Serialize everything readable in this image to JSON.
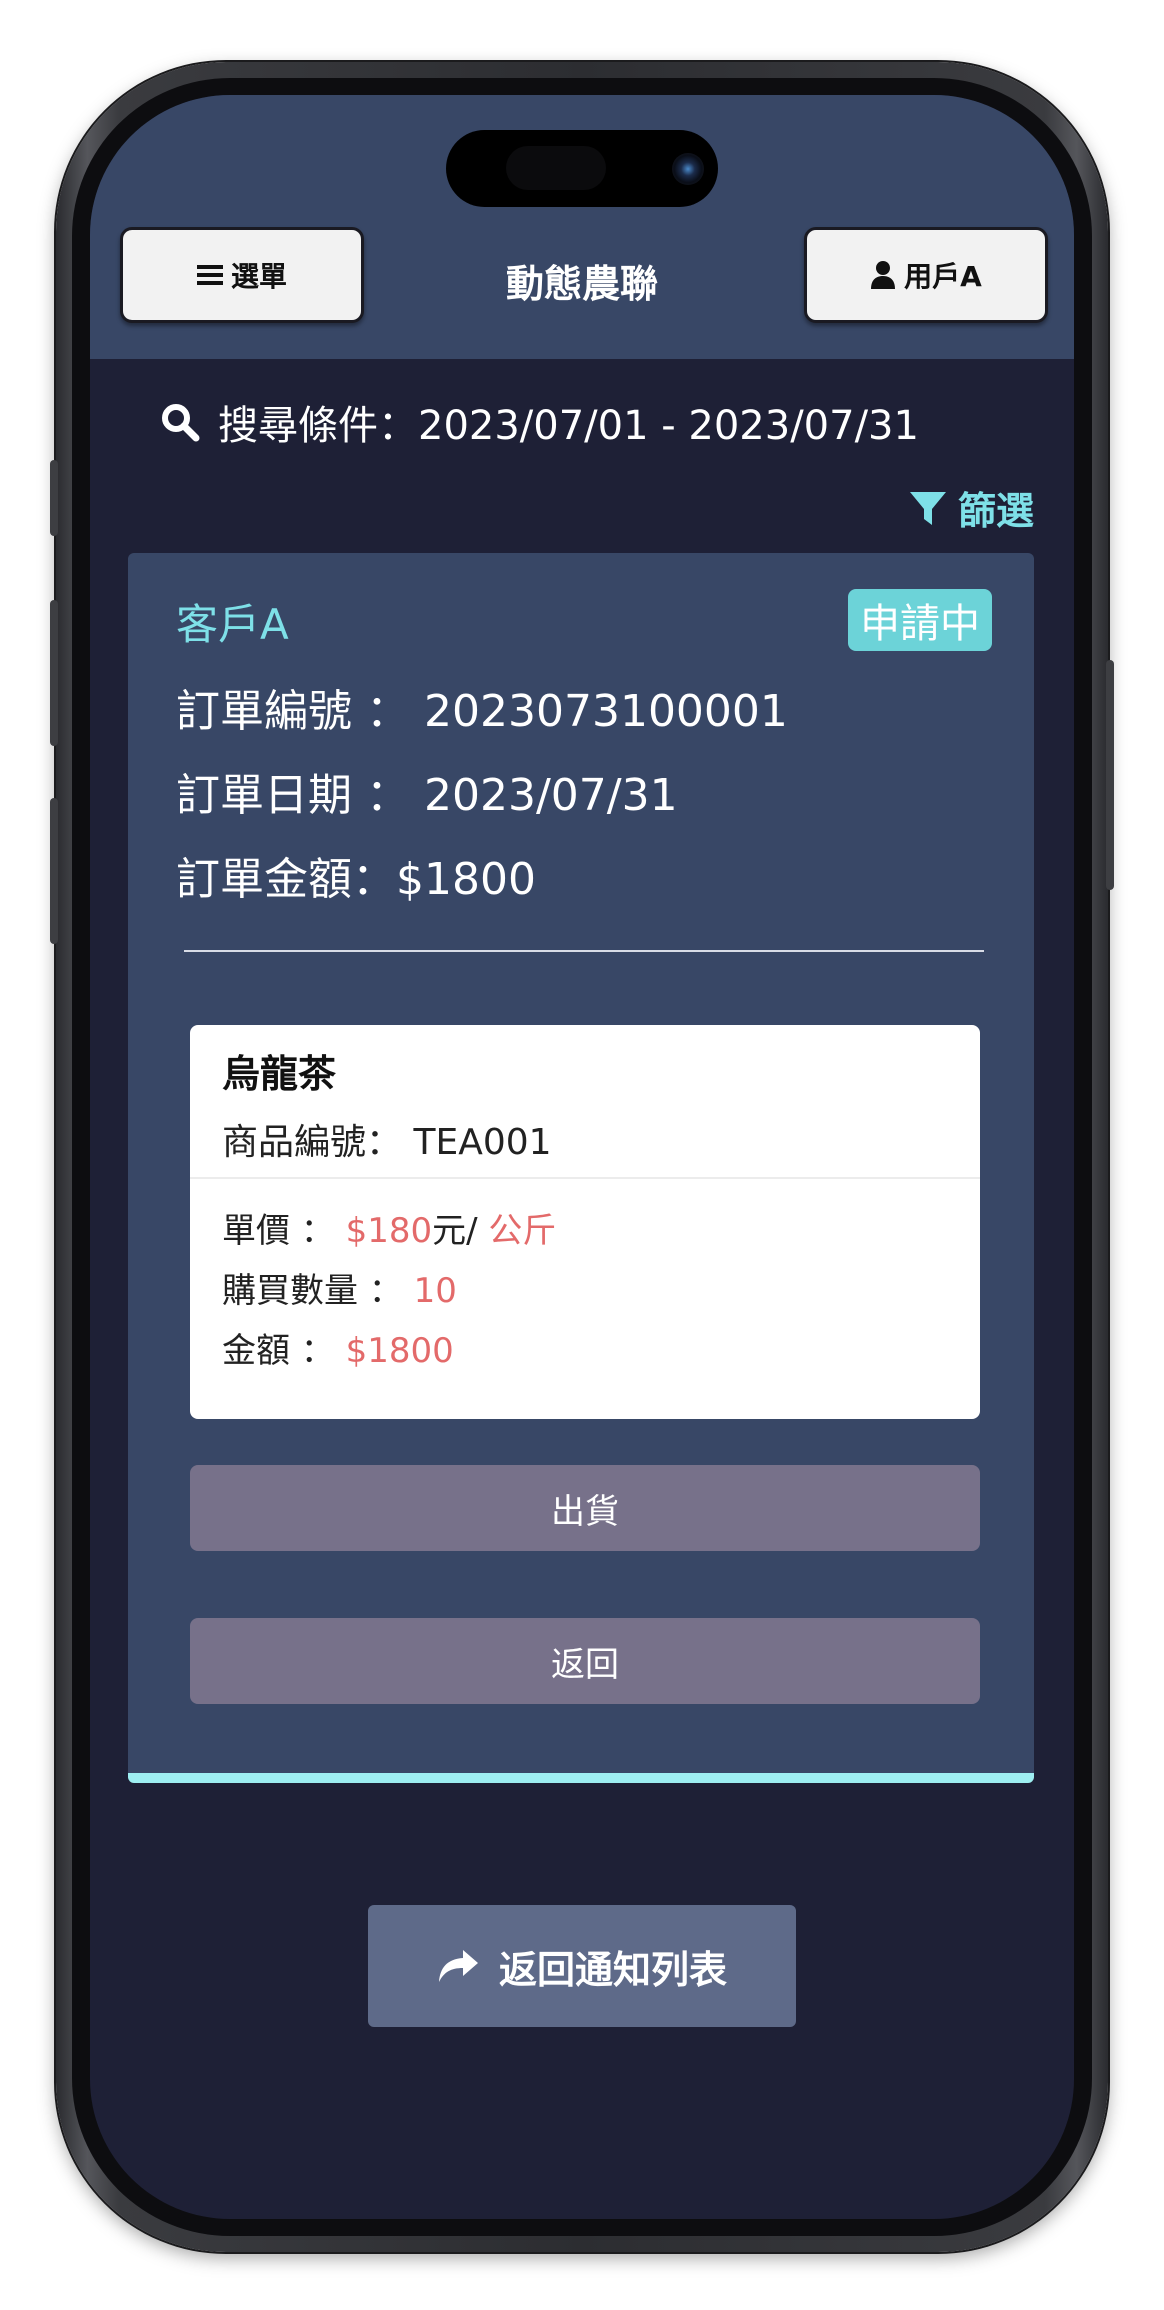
{
  "header": {
    "menu_label": "選單",
    "title": "動態農聯",
    "user_label": "用戶A",
    "menu_icon": "hamburger-icon",
    "user_icon": "user-icon"
  },
  "search": {
    "icon": "search-icon",
    "text": "搜尋條件：2023/07/01 - 2023/07/31"
  },
  "filter": {
    "icon": "filter-icon",
    "label": "篩選"
  },
  "order": {
    "customer": "客戶A",
    "status": "申請中",
    "number_label": "訂單編號 ： ",
    "number": "2023073100001",
    "date_label": "訂單日期 ： ",
    "date": "2023/07/31",
    "amount_label": "訂單金額：",
    "amount": "$1800"
  },
  "product": {
    "name": "烏龍茶",
    "code_label": "商品編號： ",
    "code": "TEA001",
    "price_label": "單價 ： ",
    "price": "$180",
    "price_unit_sep": "元/ ",
    "unit": "公斤",
    "qty_label": "購買數量 ： ",
    "qty": "10",
    "total_label": "金額 ： ",
    "total": "$1800"
  },
  "actions": {
    "ship_label": "出貨",
    "back_label": "返回",
    "back_list_label": "返回通知列表",
    "back_list_icon": "share-arrow-icon"
  },
  "colors": {
    "accent": "#7ee0e8",
    "header_bg": "#384766",
    "screen_bg": "#1e2036",
    "price_red": "#e36a6a",
    "button_bg": "#77718a"
  }
}
